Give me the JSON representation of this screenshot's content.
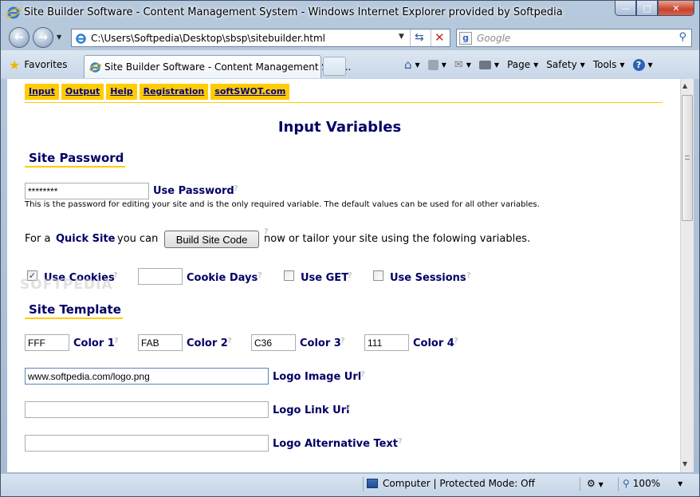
{
  "window": {
    "title": "Site Builder Software - Content Management System - Windows Internet Explorer provided by Softpedia"
  },
  "address": {
    "url": "C:\\Users\\Softpedia\\Desktop\\sbsp\\sitebuilder.html",
    "search_placeholder": "Google"
  },
  "tabs": {
    "favorites": "Favorites",
    "active_tab": "Site Builder Software - Content Management Syst..."
  },
  "commandbar": {
    "page": "Page",
    "safety": "Safety",
    "tools": "Tools"
  },
  "menu": [
    {
      "label": "Input"
    },
    {
      "label": "Output"
    },
    {
      "label": "Help"
    },
    {
      "label": "Registration"
    },
    {
      "label": "softSWOT.com"
    }
  ],
  "page": {
    "heading": "Input Variables",
    "site_password_section": "Site Password",
    "password_value": "********",
    "use_password_label": "Use Password",
    "password_note": "This is the password for editing your site and is the only required variable. The default values can be used for all other variables.",
    "quick_prefix": "For a",
    "quick_site": "Quick Site",
    "quick_mid": "you can",
    "build_button": "Build Site Code",
    "quick_suffix": "now or tailor your site using the folowing variables.",
    "use_cookies_label": "Use Cookies",
    "use_cookies_checked": true,
    "cookie_days_value": "",
    "cookie_days_label": "Cookie Days",
    "use_get_label": "Use GET",
    "use_sessions_label": "Use Sessions",
    "site_template_section": "Site Template",
    "colors": [
      {
        "value": "FFF",
        "label": "Color 1"
      },
      {
        "value": "FAB",
        "label": "Color 2"
      },
      {
        "value": "C36",
        "label": "Color 3"
      },
      {
        "value": "111",
        "label": "Color 4"
      }
    ],
    "logo_image_url_value": "www.softpedia.com/logo.png",
    "logo_image_url_label": "Logo Image Url",
    "logo_link_url_value": "",
    "logo_link_url_label": "Logo Link Url",
    "logo_alt_text_value": "",
    "logo_alt_text_label": "Logo Alternative Text",
    "help_mark": "?",
    "watermark": "SOFTPEDIA"
  },
  "status": {
    "zone": "Computer | Protected Mode: Off",
    "zoom": "100%"
  },
  "colors": {
    "accent": "#ffcc00",
    "label": "#000066"
  }
}
